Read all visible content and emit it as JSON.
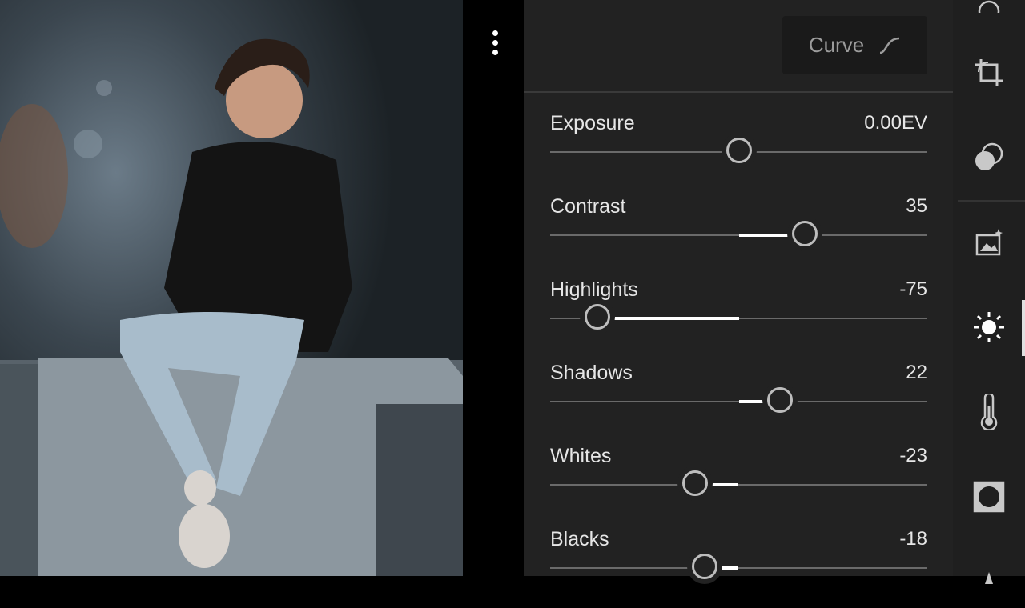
{
  "photo": {
    "alt": "Portrait photo"
  },
  "header": {
    "curve_label": "Curve"
  },
  "adjustments": [
    {
      "id": "exposure",
      "label": "Exposure",
      "value": "0.00EV",
      "level": 0.0,
      "min": -5,
      "max": 5,
      "num": 0
    },
    {
      "id": "contrast",
      "label": "Contrast",
      "value": "35",
      "num": 35,
      "min": -100,
      "max": 100
    },
    {
      "id": "highlights",
      "label": "Highlights",
      "value": "-75",
      "num": -75,
      "min": -100,
      "max": 100
    },
    {
      "id": "shadows",
      "label": "Shadows",
      "value": "22",
      "num": 22,
      "min": -100,
      "max": 100
    },
    {
      "id": "whites",
      "label": "Whites",
      "value": "-23",
      "num": -23,
      "min": -100,
      "max": 100
    },
    {
      "id": "blacks",
      "label": "Blacks",
      "value": "-18",
      "num": -18,
      "min": -100,
      "max": 100
    }
  ],
  "toolbar": [
    "crop-icon",
    "mask-icon",
    "auto-enhance-icon",
    "light-icon",
    "color-temp-icon",
    "vignette-icon"
  ],
  "colors": {
    "panel": "#222222",
    "track": "#6a6a6a",
    "fill": "#ffffff",
    "accent": "#e0e0e0"
  }
}
